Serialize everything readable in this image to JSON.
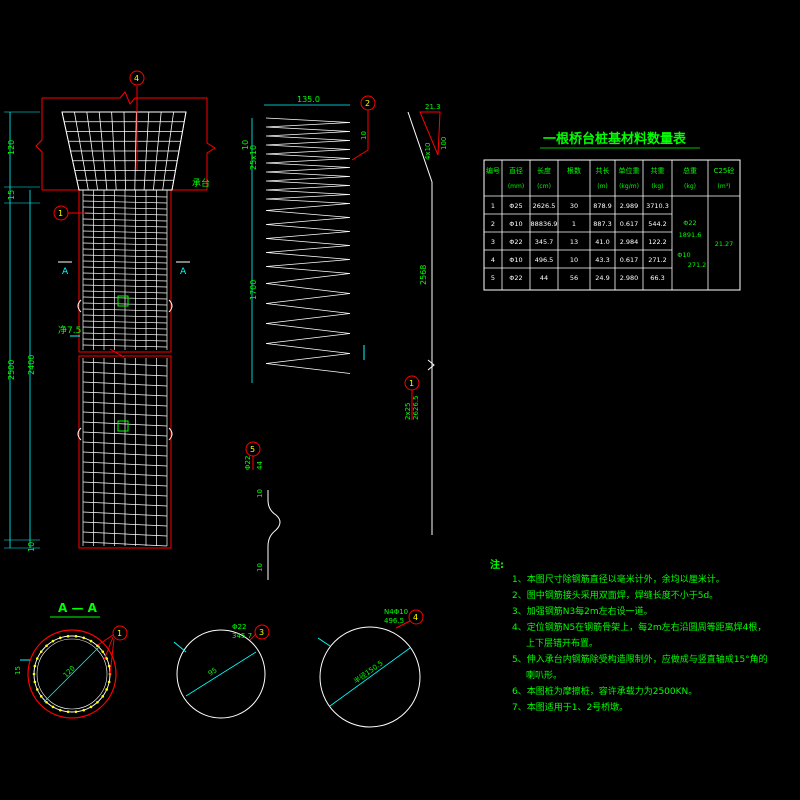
{
  "title": "一根桥台桩基材料数量表",
  "table": {
    "headers": [
      "编号",
      "直径",
      "长度",
      "根数",
      "共长",
      "单位重",
      "共重",
      "总重",
      "C25砼"
    ],
    "units": [
      "",
      "(mm)",
      "(cm)",
      "",
      "(m)",
      "(kg/m)",
      "(kg)",
      "(kg)",
      "(m³)"
    ],
    "rows": [
      [
        "1",
        "Φ25",
        "2626.5",
        "30",
        "878.9",
        "2.989",
        "3710.3"
      ],
      [
        "2",
        "Φ10",
        "88836.9",
        "1",
        "887.3",
        "0.617",
        "544.2"
      ],
      [
        "3",
        "Φ22",
        "345.7",
        "13",
        "41.0",
        "2.984",
        "122.2"
      ],
      [
        "4",
        "Φ10",
        "496.5",
        "10",
        "43.3",
        "0.617",
        "271.2"
      ],
      [
        "5",
        "Φ22",
        "44",
        "56",
        "24.9",
        "2.980",
        "66.3"
      ]
    ],
    "total_a": "Φ22",
    "total_a_val": "1891.6",
    "total_b": "Φ10",
    "total_b_val": "271.2",
    "concrete": "21.27"
  },
  "notes_title": "注:",
  "notes": [
    "1、本图尺寸除钢筋直径以毫米计外，余均以厘米计。",
    "2、图中钢筋接头采用双面焊，焊缝长度不小于5d。",
    "3、加强钢筋N3每2m左右设一道。",
    "4、定位钢筋N5在钢筋骨架上，每2m左右沿圆周等距离焊4根，上下层错开布置。",
    "5、伸入承台内钢筋除受构造限制外，应做成与竖直轴成15°角的喇叭形。",
    "6、本图桩为摩擦桩，容许承载力为2500KN。",
    "7、本图适用于1、2号桥墩。"
  ],
  "section_label": "A — A",
  "cut_label_left": "A",
  "cut_label_right": "A",
  "dims": {
    "d_top": "120",
    "d_mid": "15",
    "d_pile_total": "2500",
    "d_pile_inner": "2400",
    "d_bottom": "10",
    "spiral_len": "1700",
    "spiral_top": "25x10",
    "spiral_pitch": "10",
    "bar_width": "135.0",
    "bar_len": "2568",
    "bar_side": "4x10",
    "bar_right": "100",
    "bar_small": "21.3",
    "n1_label": "2x25",
    "n1_len": "2626.5",
    "cap_label": "承台",
    "dim_75": "净7.5",
    "spacer_a": "10",
    "spacer_b": "10",
    "spacer_lab": "Φ22",
    "spacer_44": "44",
    "sec_d": "120",
    "circ2_d": "95",
    "circ3_a": "Φ22",
    "circ3_b": "345.7",
    "circ4_a": "N4Φ10",
    "circ4_b": "496.5",
    "circ4_d": "半径150.5"
  },
  "callouts": [
    "1",
    "2",
    "3",
    "4",
    "5"
  ],
  "colors": {
    "background": "#000000",
    "rebar": "#ffffff",
    "outline": "#ff0000",
    "dimension": "#00ffff",
    "text": "#00ff00",
    "callout": "#ff0000"
  }
}
